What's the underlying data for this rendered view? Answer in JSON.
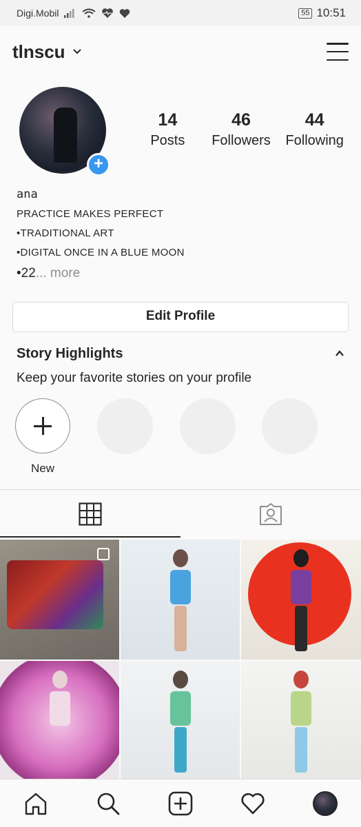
{
  "status_bar": {
    "carrier": "Digi.Mobil",
    "battery": "55",
    "time": "10:51"
  },
  "header": {
    "username": "tlnscu"
  },
  "profile": {
    "stats": [
      {
        "value": "14",
        "label": "Posts"
      },
      {
        "value": "46",
        "label": "Followers"
      },
      {
        "value": "44",
        "label": "Following"
      }
    ],
    "bio": {
      "name": "ana",
      "lines": [
        "PRACTICE MAKES PERFECT",
        "•TRADITIONAL ART",
        "•DIGITAL ONCE IN A BLUE MOON"
      ],
      "truncated": "•22",
      "more": "... more"
    },
    "edit_button": "Edit Profile"
  },
  "highlights": {
    "title": "Story Highlights",
    "subtitle": "Keep your favorite stories on your profile",
    "new_label": "New"
  },
  "colors": {
    "accent": "#3897f0",
    "text": "#262626",
    "muted": "#8e8e8e"
  }
}
